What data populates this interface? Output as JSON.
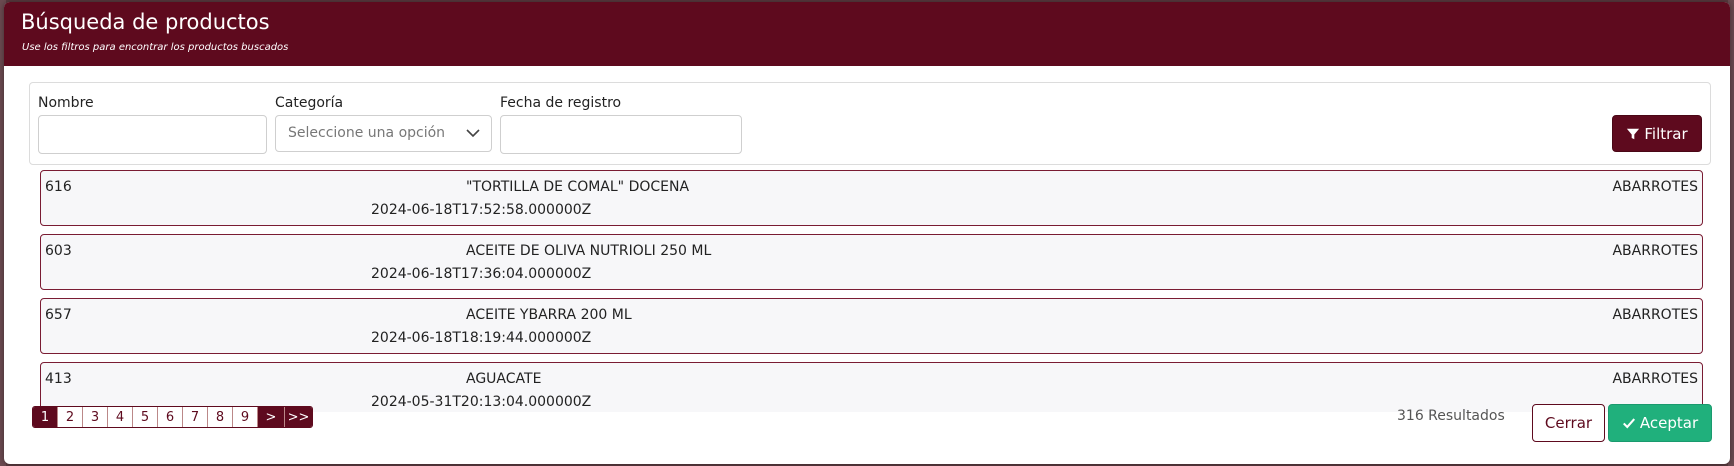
{
  "modal": {
    "title": "Búsqueda de productos",
    "subtitle": "Use los filtros para encontrar los productos buscados"
  },
  "filters": {
    "name_label": "Nombre",
    "name_value": "",
    "category_label": "Categoría",
    "category_placeholder": "Seleccione una opción",
    "date_label": "Fecha de registro",
    "date_value": "",
    "filter_button": "Filtrar"
  },
  "results": [
    {
      "id": "616",
      "name": "\"TORTILLA DE COMAL\" DOCENA",
      "date": "2024-06-18T17:52:58.000000Z",
      "category": "ABARROTES"
    },
    {
      "id": "603",
      "name": "ACEITE DE OLIVA NUTRIOLI 250 ML",
      "date": "2024-06-18T17:36:04.000000Z",
      "category": "ABARROTES"
    },
    {
      "id": "657",
      "name": "ACEITE YBARRA 200 ML",
      "date": "2024-06-18T18:19:44.000000Z",
      "category": "ABARROTES"
    },
    {
      "id": "413",
      "name": "AGUACATE",
      "date": "2024-05-31T20:13:04.000000Z",
      "category": "ABARROTES"
    }
  ],
  "pagination": {
    "pages": [
      "1",
      "2",
      "3",
      "4",
      "5",
      "6",
      "7",
      "8",
      "9"
    ],
    "active": "1",
    "next_label": ">",
    "last_label": ">>"
  },
  "footer": {
    "results_count": "316 Resultados",
    "cancel_button": "Cerrar",
    "accept_button": "Aceptar"
  },
  "colors": {
    "brand": "#5e0a1e",
    "accept": "#20b07c"
  }
}
